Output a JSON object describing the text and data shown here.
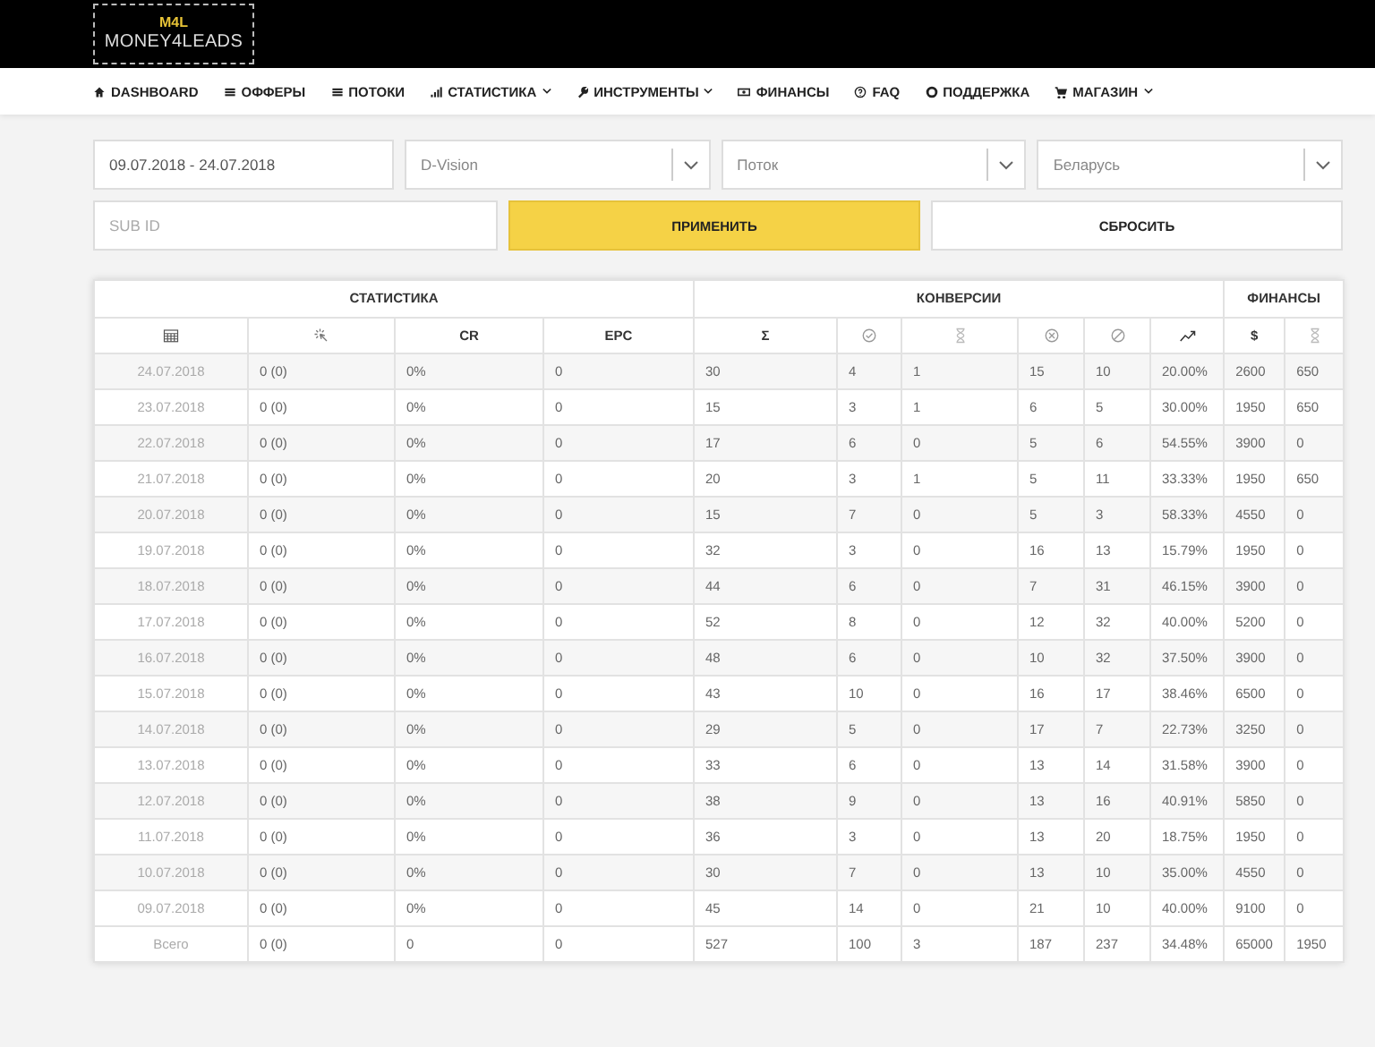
{
  "logo": {
    "mark": "M4L",
    "name": "MONEY4LEADS"
  },
  "nav": [
    {
      "label": "DASHBOARD",
      "has_menu": false
    },
    {
      "label": "ОФФЕРЫ",
      "has_menu": false
    },
    {
      "label": "ПОТОКИ",
      "has_menu": false
    },
    {
      "label": "СТАТИСТИКА",
      "has_menu": true
    },
    {
      "label": "ИНСТРУМЕНТЫ",
      "has_menu": true
    },
    {
      "label": "ФИНАНСЫ",
      "has_menu": false
    },
    {
      "label": "FAQ",
      "has_menu": false
    },
    {
      "label": "ПОДДЕРЖКА",
      "has_menu": false
    },
    {
      "label": "МАГАЗИН",
      "has_menu": true
    }
  ],
  "filters": {
    "date_range": "09.07.2018 - 24.07.2018",
    "selects": [
      "D-Vision",
      "Поток",
      "Беларусь"
    ],
    "sub_id": {
      "placeholder": "SUB ID"
    },
    "apply": "ПРИМЕНИТЬ",
    "reset": "СБРОСИТЬ"
  },
  "table": {
    "groups": [
      {
        "label": "СТАТИСТИКА"
      },
      {
        "label": "КОНВЕРСИИ"
      },
      {
        "label": "ФИНАНСЫ"
      }
    ],
    "columns": [
      {
        "kind": "icon"
      },
      {
        "kind": "icon"
      },
      {
        "kind": "text",
        "label": "CR"
      },
      {
        "kind": "text",
        "label": "EPC"
      },
      {
        "kind": "text",
        "label": "Σ"
      },
      {
        "kind": "icon"
      },
      {
        "kind": "icon"
      },
      {
        "kind": "icon"
      },
      {
        "kind": "icon"
      },
      {
        "kind": "icon"
      },
      {
        "kind": "text",
        "label": "$"
      },
      {
        "kind": "icon"
      }
    ],
    "rows": [
      [
        "24.07.2018",
        "0 (0)",
        "0%",
        "0",
        "30",
        "4",
        "1",
        "15",
        "10",
        "20.00%",
        "2600",
        "650"
      ],
      [
        "23.07.2018",
        "0 (0)",
        "0%",
        "0",
        "15",
        "3",
        "1",
        "6",
        "5",
        "30.00%",
        "1950",
        "650"
      ],
      [
        "22.07.2018",
        "0 (0)",
        "0%",
        "0",
        "17",
        "6",
        "0",
        "5",
        "6",
        "54.55%",
        "3900",
        "0"
      ],
      [
        "21.07.2018",
        "0 (0)",
        "0%",
        "0",
        "20",
        "3",
        "1",
        "5",
        "11",
        "33.33%",
        "1950",
        "650"
      ],
      [
        "20.07.2018",
        "0 (0)",
        "0%",
        "0",
        "15",
        "7",
        "0",
        "5",
        "3",
        "58.33%",
        "4550",
        "0"
      ],
      [
        "19.07.2018",
        "0 (0)",
        "0%",
        "0",
        "32",
        "3",
        "0",
        "16",
        "13",
        "15.79%",
        "1950",
        "0"
      ],
      [
        "18.07.2018",
        "0 (0)",
        "0%",
        "0",
        "44",
        "6",
        "0",
        "7",
        "31",
        "46.15%",
        "3900",
        "0"
      ],
      [
        "17.07.2018",
        "0 (0)",
        "0%",
        "0",
        "52",
        "8",
        "0",
        "12",
        "32",
        "40.00%",
        "5200",
        "0"
      ],
      [
        "16.07.2018",
        "0 (0)",
        "0%",
        "0",
        "48",
        "6",
        "0",
        "10",
        "32",
        "37.50%",
        "3900",
        "0"
      ],
      [
        "15.07.2018",
        "0 (0)",
        "0%",
        "0",
        "43",
        "10",
        "0",
        "16",
        "17",
        "38.46%",
        "6500",
        "0"
      ],
      [
        "14.07.2018",
        "0 (0)",
        "0%",
        "0",
        "29",
        "5",
        "0",
        "17",
        "7",
        "22.73%",
        "3250",
        "0"
      ],
      [
        "13.07.2018",
        "0 (0)",
        "0%",
        "0",
        "33",
        "6",
        "0",
        "13",
        "14",
        "31.58%",
        "3900",
        "0"
      ],
      [
        "12.07.2018",
        "0 (0)",
        "0%",
        "0",
        "38",
        "9",
        "0",
        "13",
        "16",
        "40.91%",
        "5850",
        "0"
      ],
      [
        "11.07.2018",
        "0 (0)",
        "0%",
        "0",
        "36",
        "3",
        "0",
        "13",
        "20",
        "18.75%",
        "1950",
        "0"
      ],
      [
        "10.07.2018",
        "0 (0)",
        "0%",
        "0",
        "30",
        "7",
        "0",
        "13",
        "10",
        "35.00%",
        "4550",
        "0"
      ],
      [
        "09.07.2018",
        "0 (0)",
        "0%",
        "0",
        "45",
        "14",
        "0",
        "21",
        "10",
        "40.00%",
        "9100",
        "0"
      ]
    ],
    "total": [
      "Всего",
      "0 (0)",
      "0",
      "0",
      "527",
      "100",
      "3",
      "187",
      "237",
      "34.48%",
      "65000",
      "1950"
    ]
  }
}
